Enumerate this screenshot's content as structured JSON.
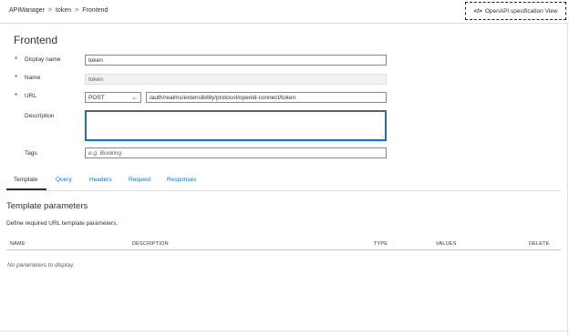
{
  "breadcrumb": {
    "items": [
      "APIManager",
      "token",
      "Frontend"
    ],
    "separator": ">"
  },
  "openapi_button": {
    "icon": "code-icon",
    "icon_glyph": "</>",
    "label": "OpenAPI specification View"
  },
  "page_title": "Frontend",
  "form": {
    "display_name": {
      "label": "Display name",
      "required": true,
      "value": "token"
    },
    "name": {
      "label": "Name",
      "required": true,
      "value": "token"
    },
    "url": {
      "label": "URL",
      "required": true,
      "method": "POST",
      "value": "/auth/realms/extensibility/protocol/openid-connect/token"
    },
    "description": {
      "label": "Description",
      "value": ""
    },
    "tags": {
      "label": "Tags",
      "placeholder": "e.g. Booking"
    }
  },
  "tabs": [
    "Template",
    "Query",
    "Headers",
    "Request",
    "Responses"
  ],
  "active_tab": "Template",
  "section": {
    "title": "Template parameters",
    "description": "Define required URL template parameters."
  },
  "table": {
    "columns": [
      "NAME",
      "DESCRIPTION",
      "TYPE",
      "VALUES",
      "DELETE"
    ],
    "empty_message": "No parameters to display."
  },
  "colors": {
    "link": "#0078d4",
    "required": "#a4262c",
    "text": "#323130"
  }
}
